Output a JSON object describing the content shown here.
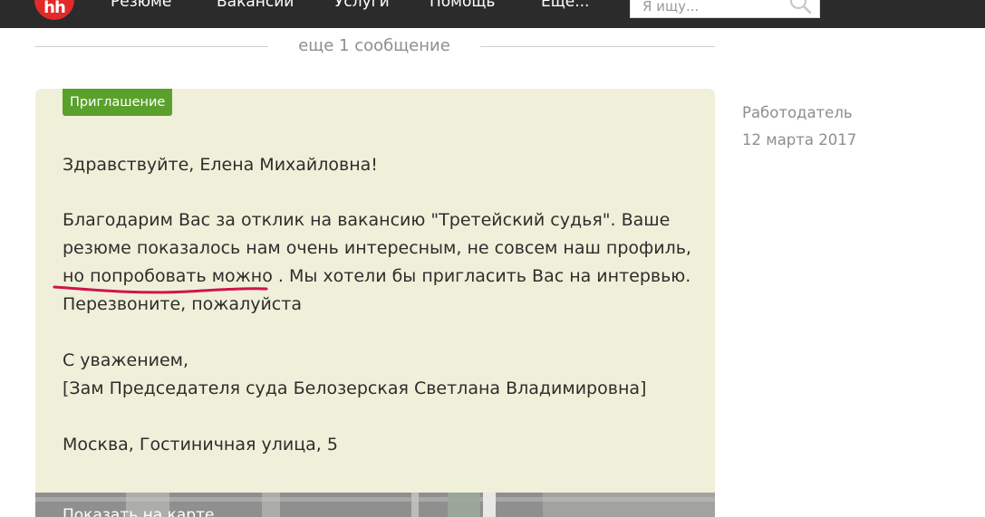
{
  "header": {
    "logo_text": "hh",
    "nav": [
      "Резюме",
      "Вакансии",
      "Услуги",
      "Помощь",
      "Еще..."
    ],
    "search_placeholder": "Я ищу..."
  },
  "thread": {
    "more_messages": "еще 1 сообщение"
  },
  "message": {
    "badge": "Приглашение",
    "greeting": "Здравствуйте, Елена Михайловна!",
    "body_line1": "Благодарим Вас за отклик на вакансию \"Третейский судья\". Ваше",
    "body_line2": "резюме показалось нам очень интересным, не совсем наш профиль,",
    "body_line3_underlined": "но попробовать можно",
    "body_line3_rest": ". Мы хотели бы пригласить Вас на интервью.",
    "body_line4": "Перезвоните, пожалуйста",
    "regards": "С уважением,",
    "signature": "[Зам Председателя суда Белозерская Светлана Владимировна]",
    "address": "Москва, Гостиничная улица, 5",
    "map_link": "Показать на карте"
  },
  "meta": {
    "sender": "Работодатель",
    "date": "12 марта 2017"
  },
  "colors": {
    "topbar": "#2b2b2b",
    "logo": "#e12a2a",
    "badge": "#5aa12b",
    "card": "#f0f0da",
    "annotation": "#d0144a"
  }
}
